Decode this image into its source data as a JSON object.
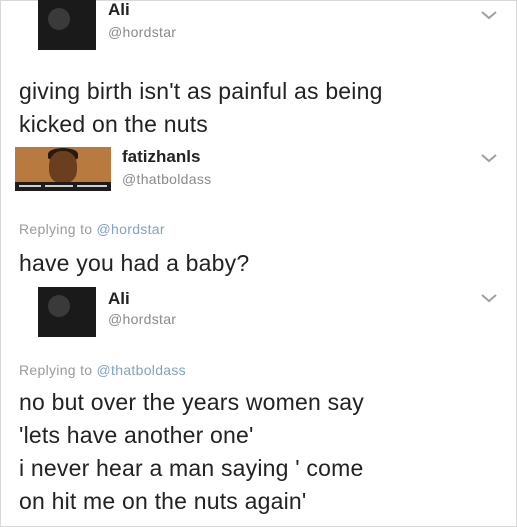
{
  "posts": [
    {
      "author_name": "Ali",
      "author_handle": "@hordstar",
      "avatar_icon": "profile-avatar-dark",
      "text_lines": [
        "giving birth isn't as painful as being",
        "kicked on the nuts"
      ]
    },
    {
      "author_name": "fatizhanls",
      "author_handle": "@thatboldass",
      "avatar_icon": "profile-avatar-photo",
      "replying_prefix": "Replying to",
      "replying_to": "@hordstar",
      "text_lines": [
        "have you had a baby?"
      ]
    },
    {
      "author_name": "Ali",
      "author_handle": "@hordstar",
      "avatar_icon": "profile-avatar-dark",
      "replying_prefix": "Replying to",
      "replying_to": "@thatboldass",
      "text_lines": [
        "no but over the years women say",
        "'lets have another one'",
        "i never hear a man saying ' come",
        "on hit me on the nuts again'"
      ]
    }
  ],
  "icons": {
    "menu": "chevron-down-icon"
  },
  "colors": {
    "text": "#222222",
    "muted": "#8a8a8a",
    "mention": "#7fa3c2"
  }
}
